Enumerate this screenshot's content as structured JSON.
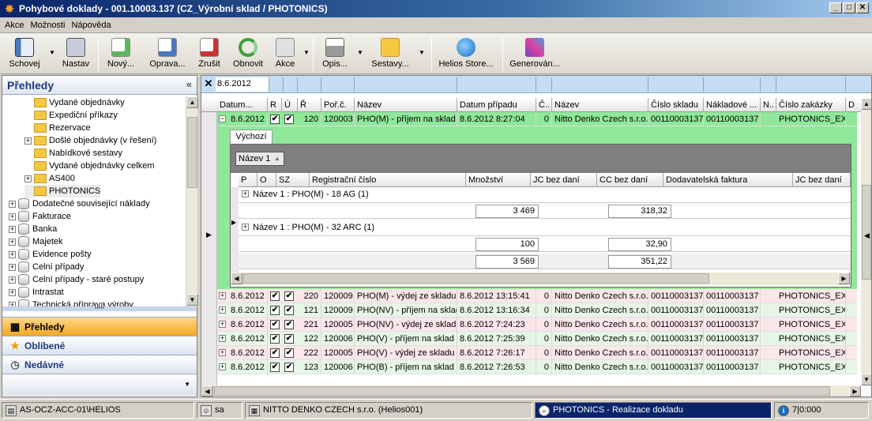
{
  "window": {
    "title": "Pohybové doklady - 001.10003.137 (CZ_Výrobní sklad / PHOTONICS)"
  },
  "menu": [
    "Akce",
    "Možnosti",
    "Nápověda"
  ],
  "toolbar": [
    {
      "label": "Schovej",
      "icon": "hide-panel-icon"
    },
    {
      "label": "Nastav",
      "icon": "settings-icon"
    },
    {
      "label": "Nový...",
      "icon": "new-doc-icon"
    },
    {
      "label": "Oprava...",
      "icon": "edit-doc-icon"
    },
    {
      "label": "Zrušit",
      "icon": "delete-doc-icon"
    },
    {
      "label": "Obnovit",
      "icon": "refresh-icon"
    },
    {
      "label": "Akce",
      "icon": "action-icon"
    },
    {
      "label": "Opis...",
      "icon": "print-icon"
    },
    {
      "label": "Sestavy...",
      "icon": "reports-folder-icon"
    },
    {
      "label": "Helios Store...",
      "icon": "globe-icon"
    },
    {
      "label": "Generován...",
      "icon": "generate-icon"
    }
  ],
  "leftpanel": {
    "title": "Přehledy",
    "collapse": "«",
    "tree": [
      {
        "label": "Vydané objednávky",
        "type": "folder",
        "indent": 2
      },
      {
        "label": "Expediční příkazy",
        "type": "folder",
        "indent": 2
      },
      {
        "label": "Rezervace",
        "type": "folder",
        "indent": 2
      },
      {
        "label": "Došlé objednávky (v řešení)",
        "type": "folder",
        "indent": 2,
        "exp": "+"
      },
      {
        "label": "Nabídkové sestavy",
        "type": "folder",
        "indent": 2
      },
      {
        "label": "Vydané objednávky celkem",
        "type": "folder",
        "indent": 2
      },
      {
        "label": "AS400",
        "type": "folder",
        "indent": 2,
        "exp": "+"
      },
      {
        "label": "PHOTONICS",
        "type": "folder",
        "indent": 2,
        "selected": true
      },
      {
        "label": "Dodatečné související náklady",
        "type": "db",
        "indent": 1,
        "exp": "+"
      },
      {
        "label": "Fakturace",
        "type": "db",
        "indent": 1,
        "exp": "+"
      },
      {
        "label": "Banka",
        "type": "db",
        "indent": 1,
        "exp": "+"
      },
      {
        "label": "Majetek",
        "type": "db",
        "indent": 1,
        "exp": "+"
      },
      {
        "label": "Evidence pošty",
        "type": "db",
        "indent": 1,
        "exp": "+"
      },
      {
        "label": "Celní případy",
        "type": "db",
        "indent": 1,
        "exp": "+"
      },
      {
        "label": "Celní případy - staré postupy",
        "type": "db",
        "indent": 1,
        "exp": "+"
      },
      {
        "label": "Intrastat",
        "type": "db",
        "indent": 1,
        "exp": "+"
      },
      {
        "label": "Technická příprava výroby",
        "type": "db",
        "indent": 1,
        "exp": "+"
      }
    ],
    "nav": [
      {
        "label": "Přehledy",
        "icon": "overview-icon",
        "active": true
      },
      {
        "label": "Oblíbené",
        "icon": "star-icon"
      },
      {
        "label": "Nedávné",
        "icon": "clock-icon"
      }
    ]
  },
  "grid": {
    "filter": {
      "value": "8.6.2012",
      "clear": "✕"
    },
    "columns": [
      "Datum...",
      "R",
      "Ú",
      "Ř",
      "Poř.č.",
      "Název",
      "Datum případu",
      "Č..",
      "Název",
      "Číslo skladu",
      "Nákladové ...",
      "N..",
      "Číslo zakázky",
      "D"
    ],
    "expanded_row": {
      "pm": "−",
      "date": "8.6.2012",
      "r": "✔",
      "u": "✔",
      "rada": "120",
      "por": "120003",
      "nazev": "PHO(M) - příjem na sklad",
      "datum_pripadu": "8.6.2012 8:27:04",
      "c": "0",
      "org": "Nitto Denko Czech s.r.o.",
      "sklad": "00110003137",
      "naklad": "00110003137",
      "zakazka": "PHOTONICS_EXP"
    },
    "detail": {
      "tab": "Výchozí",
      "group_button": "Název 1",
      "columns": [
        "P",
        "O",
        "SZ",
        "Registrační číslo",
        "Množství",
        "JC bez daní",
        "CC bez daní",
        "Dodavatelská faktura",
        "JC bez daní"
      ],
      "groups": [
        {
          "label": "Název 1 : PHO(M) - 18 AG  (1)",
          "qty": "3 469",
          "cc": "318,32"
        },
        {
          "label": "Název 1 : PHO(M) - 32 ARC  (1)",
          "qty": "100",
          "cc": "32,90"
        }
      ],
      "total": {
        "qty": "3 569",
        "cc": "351,22"
      }
    },
    "rows": [
      {
        "date": "8.6.2012",
        "r": "✔",
        "u": "✔",
        "rada": "220",
        "por": "120009",
        "nazev": "PHO(M) - výdej ze skladu",
        "datum_pripadu": "8.6.2012 13:15:41",
        "c": "0",
        "org": "Nitto Denko Czech s.r.o.",
        "sklad": "00110003137",
        "naklad": "00110003137",
        "zakazka": "PHOTONICS_EXP",
        "bg": "#fbe6ea"
      },
      {
        "date": "8.6.2012",
        "r": "✔",
        "u": "✔",
        "rada": "121",
        "por": "120009",
        "nazev": "PHO(NV) - příjem na sklad",
        "datum_pripadu": "8.6.2012 13:16:34",
        "c": "0",
        "org": "Nitto Denko Czech s.r.o.",
        "sklad": "00110003137",
        "naklad": "00110003137",
        "zakazka": "PHOTONICS_EXP",
        "bg": "#e6f6e6"
      },
      {
        "date": "8.6.2012",
        "r": "✔",
        "u": "✔",
        "rada": "221",
        "por": "120005",
        "nazev": "PHO(NV) - výdej ze skladu",
        "datum_pripadu": "8.6.2012 7:24:23",
        "c": "0",
        "org": "Nitto Denko Czech s.r.o.",
        "sklad": "00110003137",
        "naklad": "00110003137",
        "zakazka": "PHOTONICS_EXP",
        "bg": "#fbe6ea"
      },
      {
        "date": "8.6.2012",
        "r": "✔",
        "u": "✔",
        "rada": "122",
        "por": "120006",
        "nazev": "PHO(V) - příjem na sklad",
        "datum_pripadu": "8.6.2012 7:25:39",
        "c": "0",
        "org": "Nitto Denko Czech s.r.o.",
        "sklad": "00110003137",
        "naklad": "00110003137",
        "zakazka": "PHOTONICS_EXP",
        "bg": "#e6f6e6"
      },
      {
        "date": "8.6.2012",
        "r": "✔",
        "u": "✔",
        "rada": "222",
        "por": "120005",
        "nazev": "PHO(V) - výdej ze skladu",
        "datum_pripadu": "8.6.2012 7:26:17",
        "c": "0",
        "org": "Nitto Denko Czech s.r.o.",
        "sklad": "00110003137",
        "naklad": "00110003137",
        "zakazka": "PHOTONICS_EXP",
        "bg": "#fbe6ea"
      },
      {
        "date": "8.6.2012",
        "r": "✔",
        "u": "✔",
        "rada": "123",
        "por": "120006",
        "nazev": "PHO(B) - příjem na sklad",
        "datum_pripadu": "8.6.2012 7:26:53",
        "c": "0",
        "org": "Nitto Denko Czech s.r.o.",
        "sklad": "00110003137",
        "naklad": "00110003137",
        "zakazka": "PHOTONICS_EXP",
        "bg": "#e6f6e6"
      }
    ]
  },
  "status": {
    "server": "AS-OCZ-ACC-01\\HELIOS",
    "user": "sa",
    "company": "NITTO DENKO CZECH s.r.o. (Helios001)",
    "task": "PHOTONICS - Realizace dokladu",
    "info": "7|0:000"
  }
}
